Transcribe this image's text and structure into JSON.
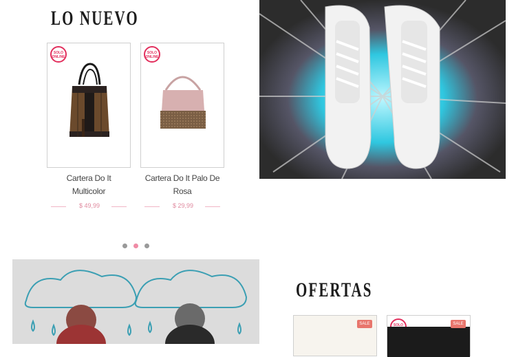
{
  "new_section": {
    "title": "LO NUEVO",
    "products": [
      {
        "name_line1": "Cartera Do It",
        "name_line2": "Multicolor",
        "price": "$ 49,99",
        "badge": "SOLO ONLINE"
      },
      {
        "name_line1": "Cartera Do It Palo De",
        "name_line2": "Rosa",
        "price": "$ 29,99",
        "badge": "SOLO ONLINE"
      }
    ],
    "carousel_dots": [
      "1",
      "2",
      "3"
    ],
    "active_dot": 2
  },
  "offers_section": {
    "title": "OFERTAS",
    "products": [
      {
        "sale_label": "SALE"
      },
      {
        "sale_label": "SALE",
        "badge": "SOLO ONLINE"
      }
    ]
  },
  "colors": {
    "accent_pink": "#f08ca6",
    "badge_red": "#e22e5c",
    "sale_tag": "#e8756c"
  },
  "icons": {
    "online_badge": "speech-bubble-badge-icon"
  }
}
